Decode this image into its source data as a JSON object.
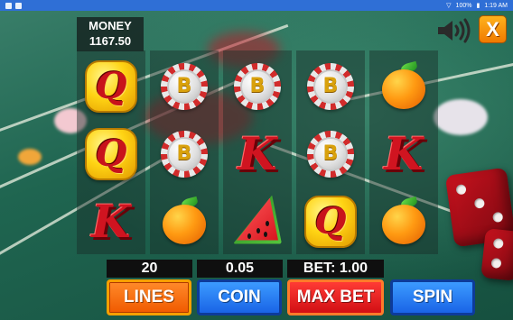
{
  "status_bar": {
    "battery": "100%",
    "time": "1:19 AM"
  },
  "money": {
    "label": "MONEY",
    "value": "1167.50"
  },
  "controls": {
    "close_label": "X"
  },
  "reels": [
    [
      "queen",
      "queen",
      "king"
    ],
    [
      "bitcoin",
      "bitcoin",
      "orange"
    ],
    [
      "bitcoin",
      "king",
      "watermelon"
    ],
    [
      "bitcoin",
      "bitcoin",
      "queen"
    ],
    [
      "orange",
      "king",
      "orange"
    ]
  ],
  "symbol_letters": {
    "queen": "Q",
    "king": "K",
    "bitcoin": "B"
  },
  "bottom": {
    "lines_value": "20",
    "coin_value": "0.05",
    "bet_text": "BET: 1.00",
    "lines_label": "LINES",
    "coin_label": "COIN",
    "max_bet_label": "MAX BET",
    "spin_label": "SPIN"
  },
  "colors": {
    "status_bar": "#2f6fd6",
    "table_felt": "#1f6550",
    "lines_button": "#f05a00",
    "coin_button": "#1a64e6",
    "max_bet_button": "#d10f14",
    "spin_button": "#1a64e6",
    "close_button": "#f07a00"
  }
}
